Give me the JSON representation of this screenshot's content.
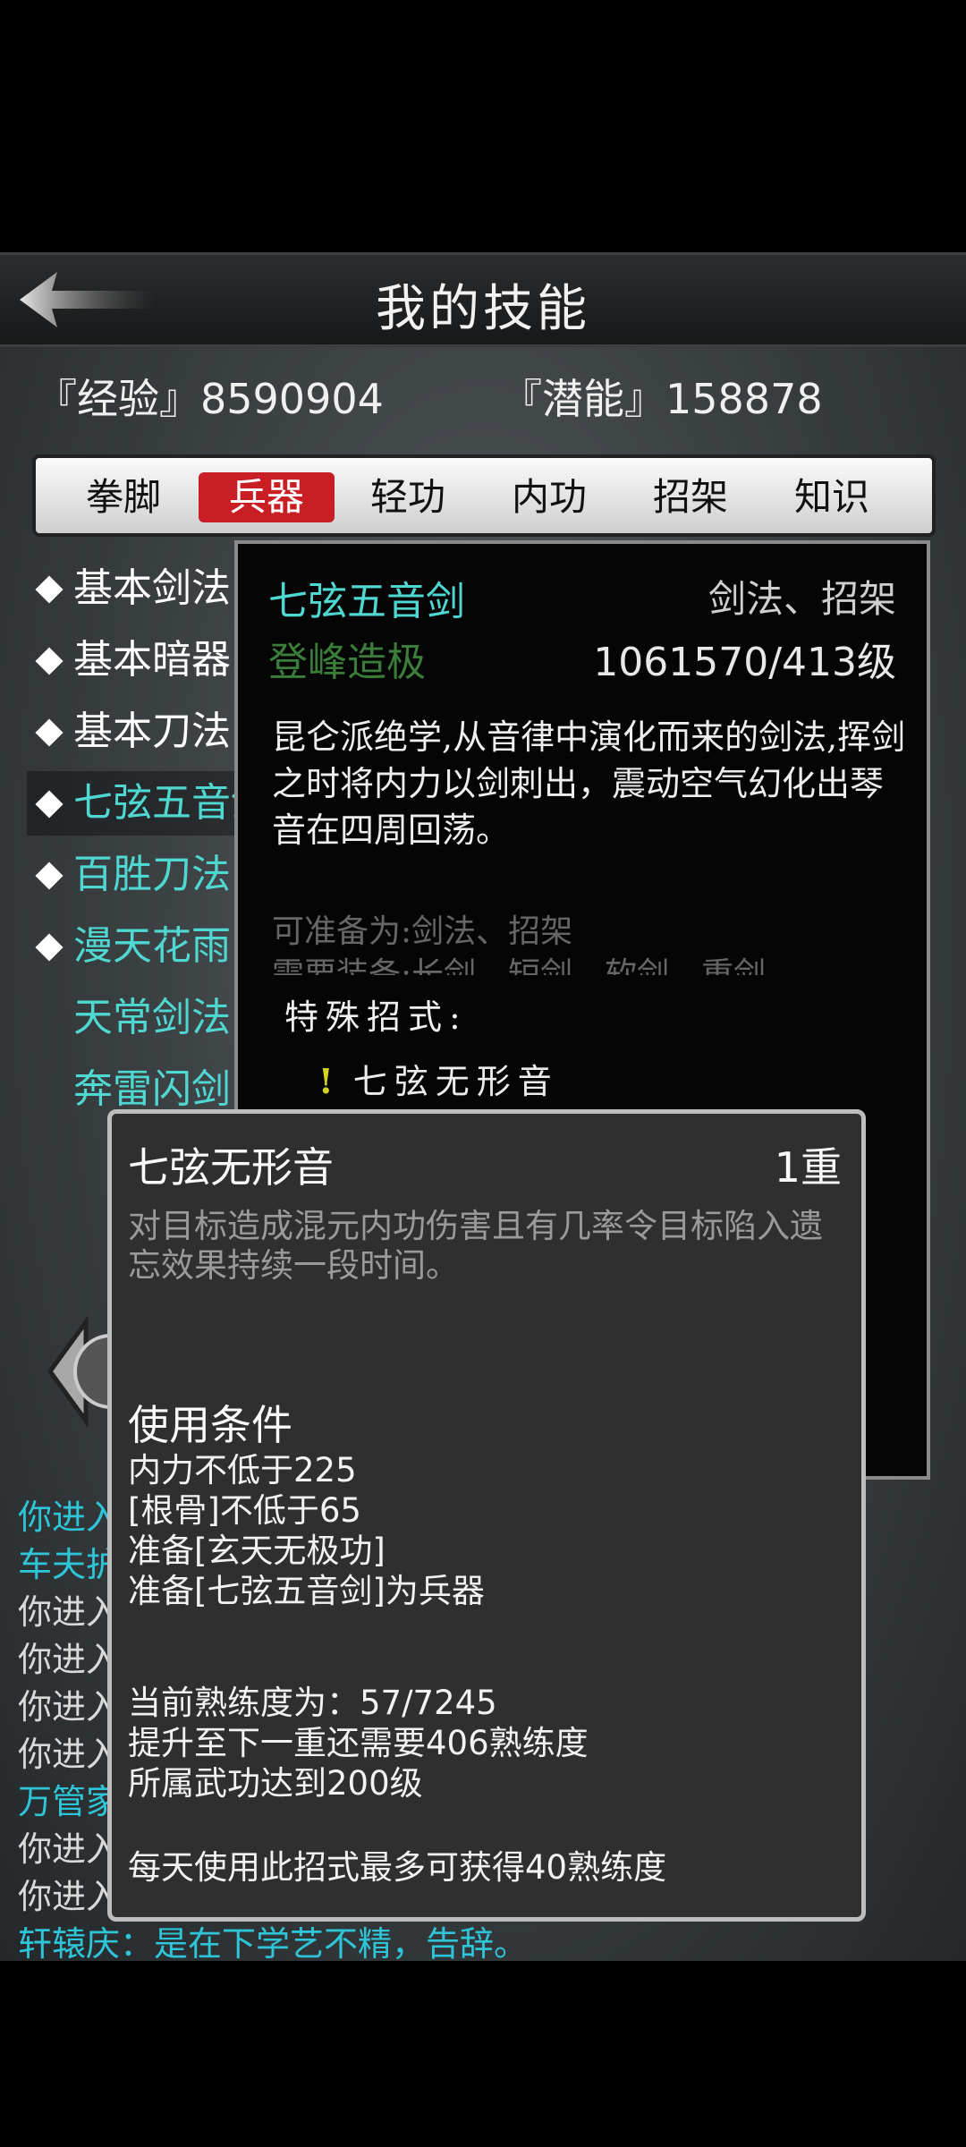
{
  "header": {
    "title": "我的技能"
  },
  "stats": {
    "exp": "『经验』8590904",
    "potential": "『潜能』158878"
  },
  "tabs": [
    "拳脚",
    "兵器",
    "轻功",
    "内功",
    "招架",
    "知识"
  ],
  "active_tab": "兵器",
  "skill_list": [
    {
      "label": "基本剑法",
      "diamond": true,
      "color": "#ffffff"
    },
    {
      "label": "基本暗器",
      "diamond": true,
      "color": "#ffffff"
    },
    {
      "label": "基本刀法",
      "diamond": true,
      "color": "#ffffff"
    },
    {
      "label": "七弦五音剑",
      "diamond": true,
      "color": "#4fd8d2",
      "selected": true
    },
    {
      "label": "百胜刀法",
      "diamond": true,
      "color": "#4fd8d2"
    },
    {
      "label": "漫天花雨",
      "diamond": true,
      "color": "#4fd8d2"
    },
    {
      "label": "天常剑法",
      "diamond": false,
      "color": "#4fd8d2"
    },
    {
      "label": "奔雷闪剑",
      "diamond": false,
      "color": "#4fd8d2"
    }
  ],
  "detail": {
    "name": "七弦五音剑",
    "type": "剑法、招架",
    "level_name": "登峰造极",
    "progress": "1061570/413级",
    "description": "昆仑派绝学,从音律中演化而来的剑法,挥剑之时将内力以剑刺出，震动空气幻化出琴音在四周回荡。",
    "prep_as": "可准备为:剑法、招架",
    "equip_req": "需要装备:长剑、短剑、软剑、重剑",
    "special_title": "特殊招式:",
    "special_move": "七弦无形音"
  },
  "chat": [
    {
      "text": "你进入",
      "cyan": true
    },
    {
      "text": "车夫护",
      "cyan": true
    },
    {
      "text": "你进入",
      "cyan": false
    },
    {
      "text": "你进入",
      "cyan": false
    },
    {
      "text": "你进入",
      "cyan": false
    },
    {
      "text": "你进入",
      "cyan": false
    },
    {
      "text": "万管家",
      "cyan": true
    },
    {
      "text": "你进入",
      "cyan": false
    },
    {
      "text": "你进入",
      "cyan": false
    }
  ],
  "chat_last": {
    "speaker": "轩辕庆：",
    "text": "是在下学艺不精，告辞。"
  },
  "popup": {
    "title": "七弦无形音",
    "level": "1重",
    "description": "对目标造成混元内功伤害且有几率令目标陷入遗忘效果持续一段时间。",
    "conditions_title": "使用条件",
    "conditions": [
      "内力不低于225",
      "[根骨]不低于65",
      "准备[玄天无极功]",
      "准备[七弦五音剑]为兵器"
    ],
    "progress_lines": [
      "当前熟练度为：57/7245",
      "提升至下一重还需要406熟练度",
      "所属武功达到200级"
    ],
    "daily": "每天使用此招式最多可获得40熟练度"
  }
}
